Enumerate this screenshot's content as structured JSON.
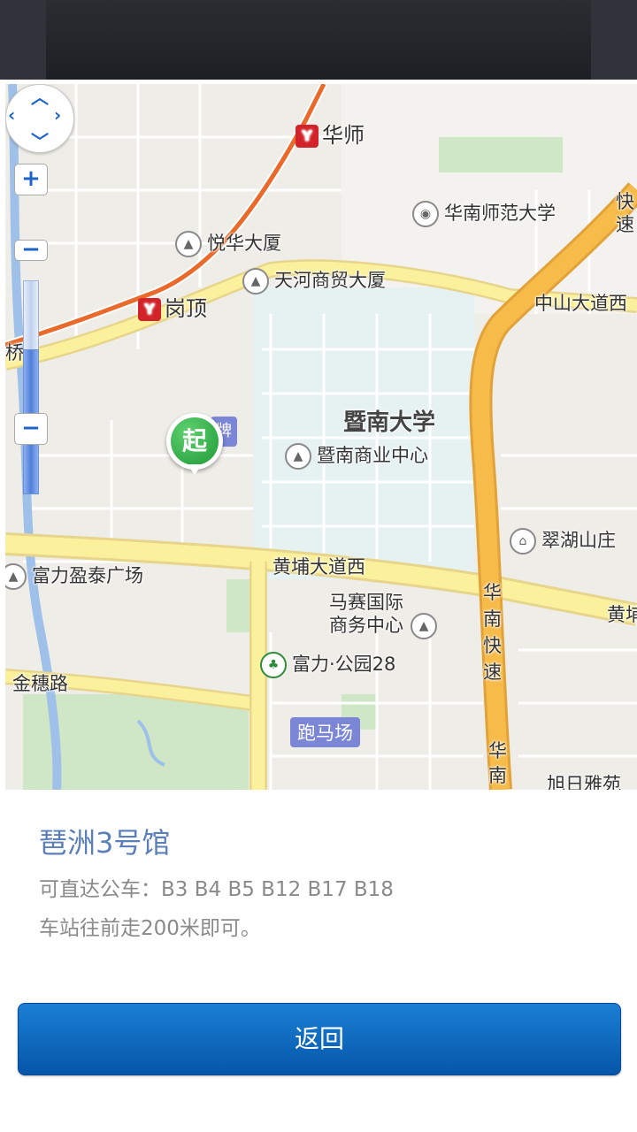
{
  "map": {
    "labels": {
      "huashi": "华师",
      "scnu": "华南师范大学",
      "yuehua": "悦华大厦",
      "tianhe_trade": "天河商贸大厦",
      "gangding": "岗顶",
      "zhongshan_road": "中山大道西",
      "qiao": "桥",
      "jinan": "暨南大学",
      "jinan_center": "暨南商业中心",
      "cuihu": "翠湖山庄",
      "fuli_yingtai": "富力盈泰广场",
      "huangpu_road": "黄埔大道西",
      "huangpu_right": "黄埔",
      "masai": "马赛国际",
      "masai2": "商务中心",
      "fuli_park": "富力·公园28",
      "jinsui": "金穗路",
      "racecourse": "跑马场",
      "huanan_express": "华南快速",
      "huanan_bottom": "华南",
      "xuri": "旭日雅苑",
      "express_top": "快速",
      "marker_char": "起",
      "sign_char": "牌"
    },
    "controls": {
      "zoom_in": "+",
      "zoom_out": "−",
      "zoom_out2": "−"
    }
  },
  "info": {
    "title": "琶洲3号馆",
    "bus": "可直达公车：B3 B4 B5 B12 B17 B18",
    "walk": "车站往前走200米即可。"
  },
  "back_button": "返回"
}
